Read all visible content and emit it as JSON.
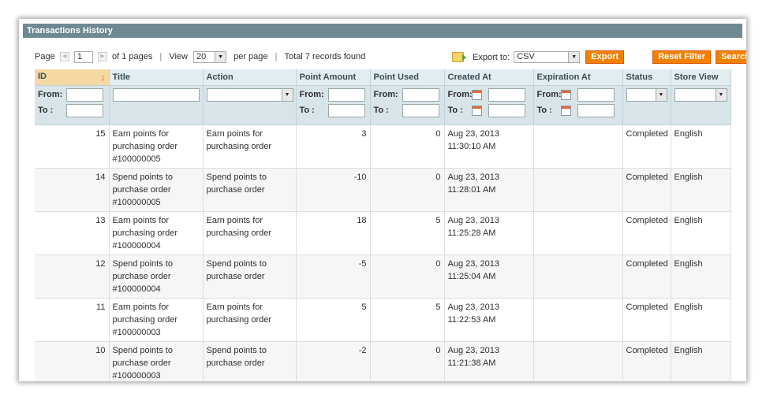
{
  "header": {
    "title": "Transactions History"
  },
  "pager": {
    "page_label": "Page",
    "page_value": "1",
    "of_pages": "of 1 pages",
    "view_label": "View",
    "per_page_value": "20",
    "per_page_label": "per page",
    "total": "Total 7 records found"
  },
  "export": {
    "label": "Export to:",
    "format": "CSV",
    "button": "Export"
  },
  "actions": {
    "reset_filter": "Reset Filter",
    "search": "Search"
  },
  "filter_labels": {
    "from": "From:",
    "to": "To :"
  },
  "columns": [
    "ID",
    "Title",
    "Action",
    "Point Amount",
    "Point Used",
    "Created At",
    "Expiration At",
    "Status",
    "Store View"
  ],
  "rows": [
    {
      "id": "15",
      "title": "Earn points for purchasing order #100000005",
      "action": "Earn points for purchasing order",
      "amount": "3",
      "used": "0",
      "created_date": "Aug 23, 2013",
      "created_time": "11:30:10 AM",
      "expiration": "",
      "status": "Completed",
      "store": "English"
    },
    {
      "id": "14",
      "title": "Spend points to purchase order #100000005",
      "action": "Spend points to purchase order",
      "amount": "-10",
      "used": "0",
      "created_date": "Aug 23, 2013",
      "created_time": "11:28:01 AM",
      "expiration": "",
      "status": "Completed",
      "store": "English"
    },
    {
      "id": "13",
      "title": "Earn points for purchasing order #100000004",
      "action": "Earn points for purchasing order",
      "amount": "18",
      "used": "5",
      "created_date": "Aug 23, 2013",
      "created_time": "11:25:28 AM",
      "expiration": "",
      "status": "Completed",
      "store": "English"
    },
    {
      "id": "12",
      "title": "Spend points to purchase order #100000004",
      "action": "Spend points to purchase order",
      "amount": "-5",
      "used": "0",
      "created_date": "Aug 23, 2013",
      "created_time": "11:25:04 AM",
      "expiration": "",
      "status": "Completed",
      "store": "English"
    },
    {
      "id": "11",
      "title": "Earn points for purchasing order #100000003",
      "action": "Earn points for purchasing order",
      "amount": "5",
      "used": "5",
      "created_date": "Aug 23, 2013",
      "created_time": "11:22:53 AM",
      "expiration": "",
      "status": "Completed",
      "store": "English"
    },
    {
      "id": "10",
      "title": "Spend points to purchase order #100000003",
      "action": "Spend points to purchase order",
      "amount": "-2",
      "used": "0",
      "created_date": "Aug 23, 2013",
      "created_time": "11:21:38 AM",
      "expiration": "",
      "status": "Completed",
      "store": "English"
    }
  ],
  "colors": {
    "header_bar": "#6f8992",
    "button": "#f18200",
    "filter_bg": "#d8e4e8",
    "sorted_col": "#f4d9a4"
  }
}
